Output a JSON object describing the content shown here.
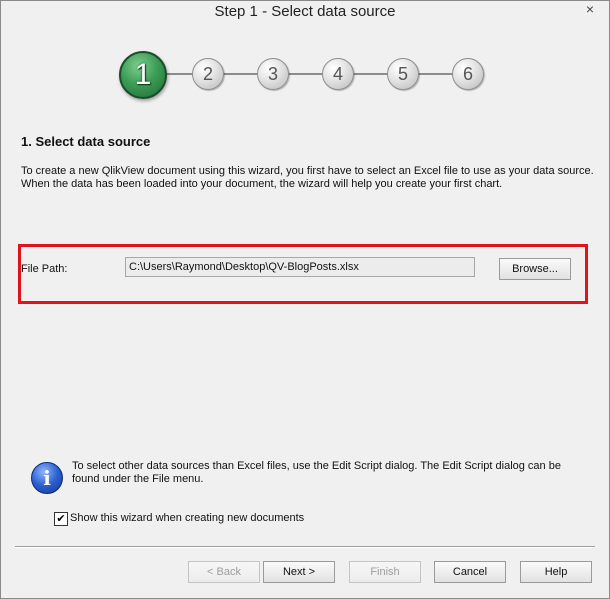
{
  "window": {
    "title": "Step 1 - Select data source",
    "close_glyph": "×"
  },
  "steps": [
    "1",
    "2",
    "3",
    "4",
    "5",
    "6"
  ],
  "current_step": 1,
  "section": {
    "heading": "1. Select data source",
    "description": "To create a new QlikView document using this wizard, you first have to select an Excel file to use as your data source. When the data has been loaded into your document, the wizard will help you create your first chart."
  },
  "file": {
    "label": "File Path:",
    "value": "C:\\Users\\Raymond\\Desktop\\QV-BlogPosts.xlsx",
    "browse_label": "Browse..."
  },
  "info": {
    "icon": "info-icon",
    "text": "To select other data sources than Excel files, use the Edit Script dialog. The Edit Script dialog can be found under the File menu."
  },
  "option": {
    "label": "Show this wizard when creating new documents",
    "checked": true,
    "check_glyph": "✔"
  },
  "buttons": {
    "back": "< Back",
    "next": "Next >",
    "finish": "Finish",
    "cancel": "Cancel",
    "help": "Help"
  },
  "colors": {
    "highlight": "#e0141e",
    "current_step": "#3d9d57",
    "info": "#2a5fd0"
  }
}
